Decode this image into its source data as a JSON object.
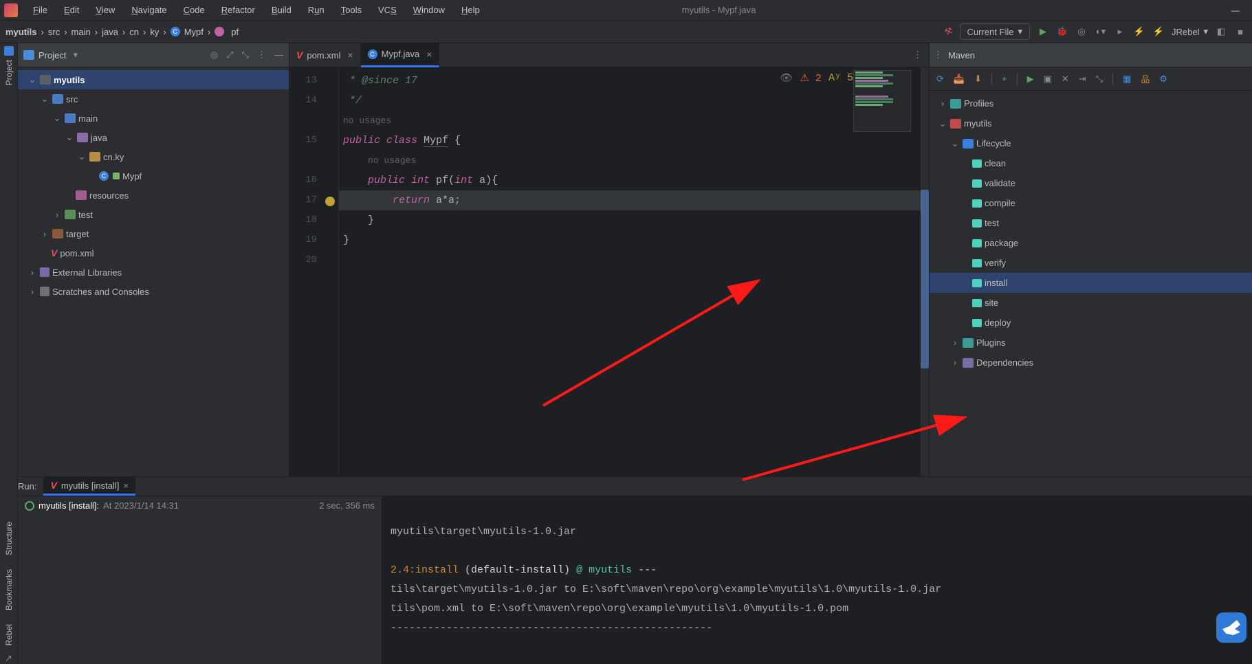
{
  "window_title": "myutils - Mypf.java",
  "menu": [
    "File",
    "Edit",
    "View",
    "Navigate",
    "Code",
    "Refactor",
    "Build",
    "Run",
    "Tools",
    "VCS",
    "Window",
    "Help"
  ],
  "breadcrumbs": [
    "myutils",
    "src",
    "main",
    "java",
    "cn",
    "ky",
    "Mypf",
    "pf"
  ],
  "run_config": "Current File",
  "jrebel_label": "JRebel",
  "project_panel": {
    "title": "Project",
    "tree": {
      "root": "myutils",
      "src": "src",
      "main": "main",
      "java": "java",
      "pkg": "cn.ky",
      "class": "Mypf",
      "resources": "resources",
      "test": "test",
      "target": "target",
      "pom": "pom.xml",
      "ext": "External Libraries",
      "scratch": "Scratches and Consoles"
    }
  },
  "project_tool_label": "Project",
  "editor": {
    "tabs": [
      {
        "label": "pom.xml",
        "icon": "v"
      },
      {
        "label": "Mypf.java",
        "icon": "class"
      }
    ],
    "gutter": [
      "13",
      "14",
      "",
      "15",
      "",
      "16",
      "17",
      "18",
      "19",
      "20"
    ],
    "lines": {
      "doc1": " * @since 17",
      "doc2": " */",
      "hint1": "no usages",
      "classdecl_kw1": "public",
      "classdecl_kw2": "class",
      "classdecl_name": "Mypf",
      "classdecl_brace": " {",
      "hint2": "no usages",
      "method_kw1": "public",
      "method_type": "int",
      "method_name": " pf(",
      "method_ptype": "int",
      "method_param": " a){",
      "ret_kw": "return",
      "ret_expr": " a*a;",
      "brace1": "}",
      "brace2": "}"
    },
    "badges": {
      "warn": "2",
      "hint": "5"
    }
  },
  "maven": {
    "title": "Maven",
    "profiles": "Profiles",
    "project": "myutils",
    "lifecycle": "Lifecycle",
    "goals": [
      "clean",
      "validate",
      "compile",
      "test",
      "package",
      "verify",
      "install",
      "site",
      "deploy"
    ],
    "plugins": "Plugins",
    "deps": "Dependencies"
  },
  "run": {
    "label": "Run:",
    "tab": "myutils [install]",
    "entry_name": "myutils [install]:",
    "entry_time": "At 2023/1/14 14:31",
    "duration": "2 sec, 356 ms",
    "console": {
      "l1": "myutils\\target\\myutils-1.0.jar",
      "l2a": "2.4:install",
      "l2b": " (default-install) ",
      "l2c": "@ ",
      "l2d": "myutils",
      "l2e": " ---",
      "l3": "tils\\target\\myutils-1.0.jar to E:\\soft\\maven\\repo\\org\\example\\myutils\\1.0\\myutils-1.0.jar",
      "l4": "tils\\pom.xml to E:\\soft\\maven\\repo\\org\\example\\myutils\\1.0\\myutils-1.0.pom",
      "l5": "----------------------------------------------------"
    }
  },
  "left_labels": {
    "structure": "Structure",
    "bookmarks": "Bookmarks",
    "rebel": "Rebel"
  }
}
